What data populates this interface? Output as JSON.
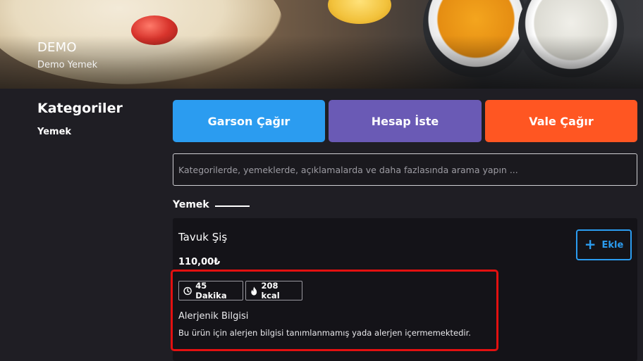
{
  "header": {
    "title": "DEMO",
    "subtitle": "Demo Yemek"
  },
  "sidebar": {
    "title": "Kategoriler",
    "items": [
      {
        "label": "Yemek"
      }
    ]
  },
  "actions": {
    "waiter": "Garson Çağır",
    "bill": "Hesap İste",
    "valet": "Vale Çağır",
    "colors": {
      "waiter": "#2b9cf0",
      "bill": "#6a5ab5",
      "valet": "#ff5622"
    }
  },
  "search": {
    "placeholder": "Kategorilerde, yemeklerde, açıklamalarda ve daha fazlasında arama yapın ...",
    "value": ""
  },
  "section": {
    "title": "Yemek"
  },
  "products": [
    {
      "name": "Tavuk Şiş",
      "price": "110,00₺",
      "add_label": "Ekle",
      "add_icon": "plus-icon",
      "prep_time": "45 Dakika",
      "prep_icon": "clock-icon",
      "calories": "208 kcal",
      "calories_icon": "flame-icon",
      "allergen_title": "Alerjenik Bilgisi",
      "allergen_text": "Bu ürün için alerjen bilgisi tanımlanmamış yada alerjen içermemektedir."
    }
  ],
  "annotation": {
    "highlight_color": "#e31010"
  }
}
